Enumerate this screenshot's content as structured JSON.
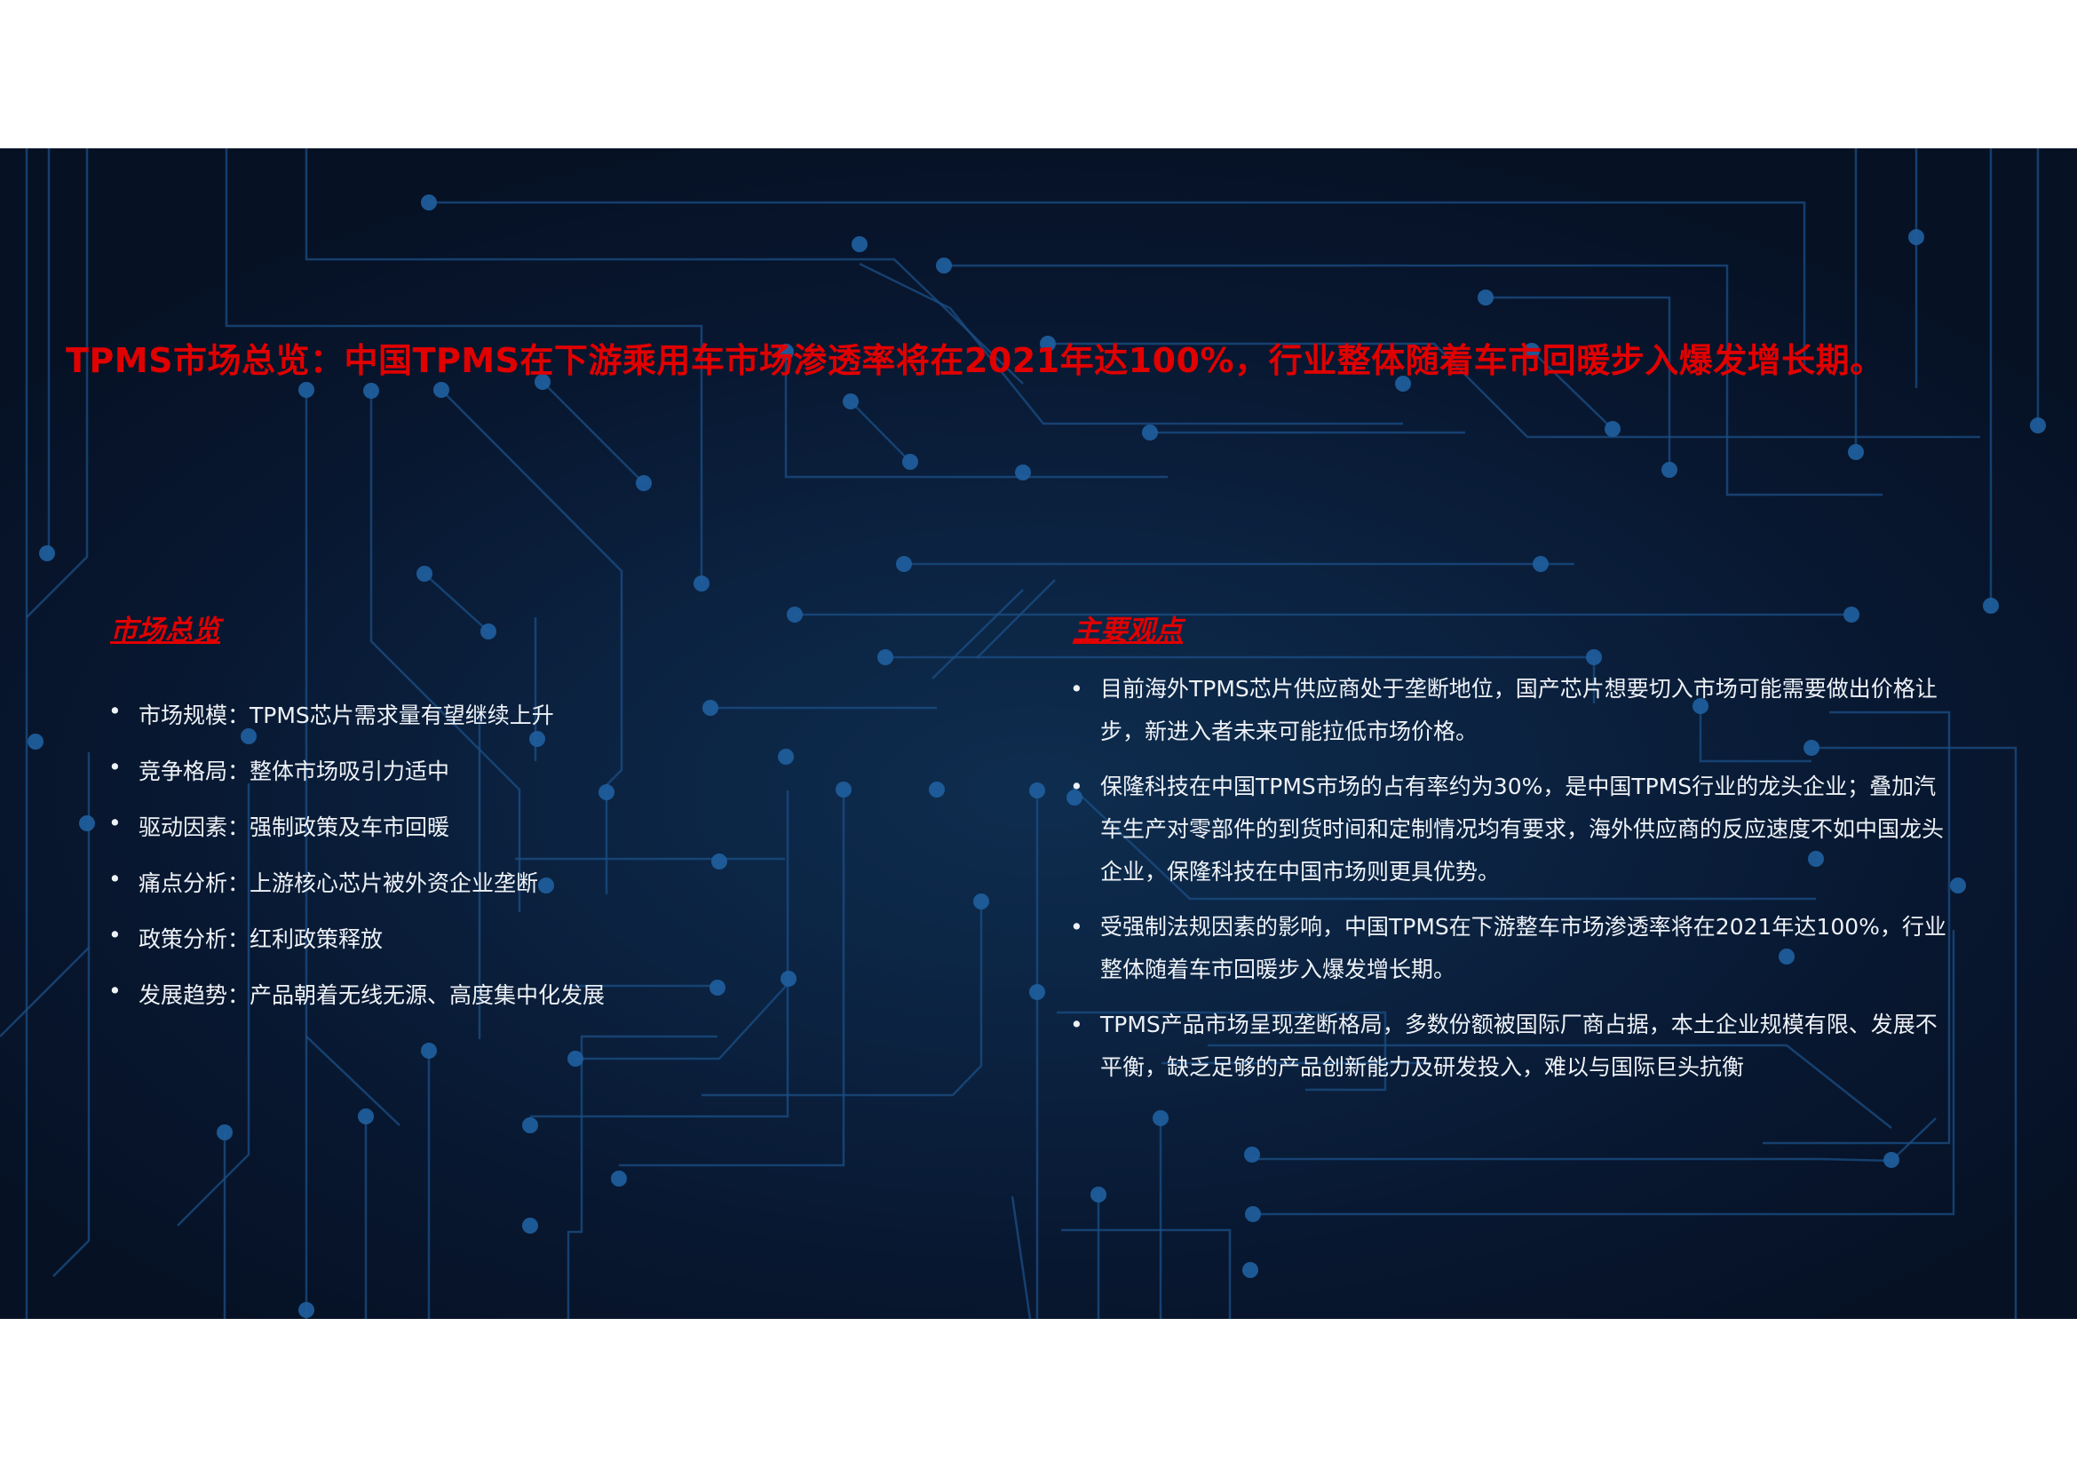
{
  "headline": "TPMS市场总览：中国TPMS在下游乘用车市场渗透率将在2021年达100%，行业整体随着车市回暖步入爆发增长期。",
  "left_section": {
    "title": "市场总览",
    "items": [
      "市场规模：TPMS芯片需求量有望继续上升",
      "竞争格局：整体市场吸引力适中",
      "驱动因素：强制政策及车市回暖",
      "痛点分析：上游核心芯片被外资企业垄断",
      "政策分析：红利政策释放",
      "发展趋势：产品朝着无线无源、高度集中化发展"
    ]
  },
  "right_section": {
    "title": "主要观点",
    "items": [
      "目前海外TPMS芯片供应商处于垄断地位，国产芯片想要切入市场可能需要做出价格让步，新进入者未来可能拉低市场价格。",
      "保隆科技在中国TPMS市场的占有率约为30%，是中国TPMS行业的龙头企业；叠加汽车生产对零部件的到货时间和定制情况均有要求，海外供应商的反应速度不如中国龙头企业，保隆科技在中国市场则更具优势。",
      "受强制法规因素的影响，中国TPMS在下游整车市场渗透率将在2021年达100%，行业整体随着车市回暖步入爆发增长期。",
      "TPMS产品市场呈现垄断格局，多数份额被国际厂商占据，本土企业规模有限、发展不平衡，缺乏足够的产品创新能力及研发投入，难以与国际巨头抗衡"
    ]
  },
  "bullet_symbol": "•",
  "colors": {
    "accent_red": "#e00000",
    "background": "#081730",
    "circuit_line": "#1b4f86",
    "text": "#eef2f7"
  }
}
